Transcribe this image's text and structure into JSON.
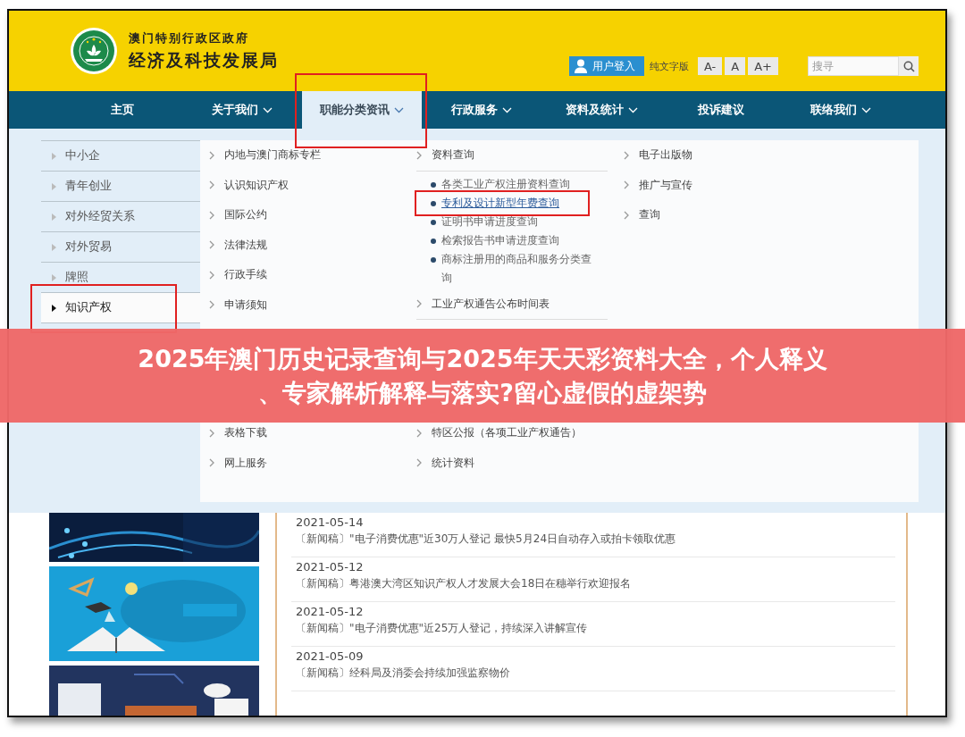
{
  "header": {
    "agency_line_1": "澳门特别行政区政府",
    "agency_line_2": "经济及科技发展局",
    "login_button": "用户登入",
    "text_only_link": "纯文字版",
    "font_size_buttons": [
      "A-",
      "A",
      "A+"
    ],
    "search": {
      "placeholder": "搜寻"
    }
  },
  "nav": [
    {
      "label": "主页",
      "has_menu": false,
      "selected": false,
      "highlighted": false
    },
    {
      "label": "关于我们",
      "has_menu": true,
      "selected": false,
      "highlighted": false
    },
    {
      "label": "职能分类资讯",
      "has_menu": true,
      "selected": true,
      "highlighted": true
    },
    {
      "label": "行政服务",
      "has_menu": true,
      "selected": false,
      "highlighted": false
    },
    {
      "label": "资料及统计",
      "has_menu": true,
      "selected": false,
      "highlighted": false
    },
    {
      "label": "投诉建议",
      "has_menu": false,
      "selected": false,
      "highlighted": false
    },
    {
      "label": "联络我们",
      "has_menu": true,
      "selected": false,
      "highlighted": false
    }
  ],
  "mega_menu": {
    "side_items": [
      {
        "label": "中小企",
        "selected": false,
        "highlighted": false
      },
      {
        "label": "青年创业",
        "selected": false,
        "highlighted": false
      },
      {
        "label": "对外经贸关系",
        "selected": false,
        "highlighted": false
      },
      {
        "label": "对外贸易",
        "selected": false,
        "highlighted": false
      },
      {
        "label": "牌照",
        "selected": false,
        "highlighted": false
      },
      {
        "label": "知识产权",
        "selected": true,
        "highlighted": true
      }
    ],
    "column_1": {
      "top": [
        "内地与澳门商标专栏",
        "认识知识产权",
        "国际公约",
        "法律法规",
        "行政手续",
        "申请须知"
      ],
      "bottom": [
        "表格下载",
        "网上服务"
      ]
    },
    "column_2": {
      "top": [
        {
          "label": "资料查询",
          "children": [
            {
              "label": "各类工业产权注册资料查询",
              "hovered": false,
              "highlighted": false
            },
            {
              "label": "专利及设计新型年费查询",
              "hovered": true,
              "highlighted": true
            },
            {
              "label": "证明书申请进度查询",
              "hovered": false,
              "highlighted": false
            },
            {
              "label": "检索报告书申请进度查询",
              "hovered": false,
              "highlighted": false
            },
            {
              "label": "商标注册用的商品和服务分类查询",
              "hovered": false,
              "highlighted": false
            }
          ]
        },
        {
          "label": "工业产权通告公布时间表"
        }
      ],
      "bottom": [
        {
          "label": "特区公报（各项工业产权通告）"
        },
        {
          "label": "统计资料"
        }
      ]
    },
    "column_3": [
      "电子出版物",
      "推广与宣传",
      "查询"
    ]
  },
  "news": [
    {
      "date": "2021-05-14",
      "title": "〔新闻稿〕\"电子消费优惠\"近30万人登记 最快5月24日自动存入或拍卡领取优惠"
    },
    {
      "date": "2021-05-12",
      "title": "〔新闻稿〕粤港澳大湾区知识产权人才发展大会18日在穗举行欢迎报名"
    },
    {
      "date": "2021-05-12",
      "title": "〔新闻稿〕\"电子消费优惠\"近25万人登记，持续深入讲解宣传"
    },
    {
      "date": "2021-05-09",
      "title": "〔新闻稿〕经科局及消委会持续加强监察物价"
    }
  ],
  "overlay_banner": {
    "lines": [
      "2025年澳门历史记录查询与2025年天天彩资料大全，个人释义",
      "、专家解析解释与落实?留心虚假的虚架势"
    ]
  }
}
